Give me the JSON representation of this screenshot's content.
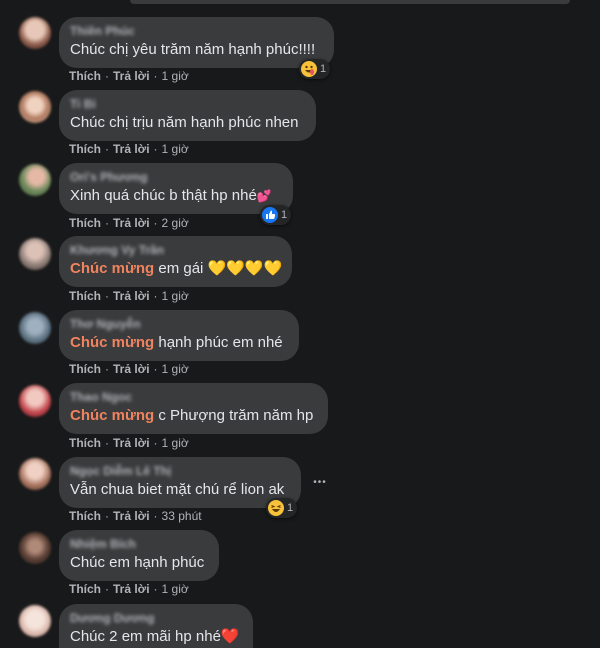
{
  "comments": [
    {
      "name": "Thiên Phúc",
      "text": "Chúc chị yêu trăm năm hạnh phúc!!!!",
      "like": "Thích",
      "reply": "Trả lời",
      "time": "1 giờ",
      "reaction_count": "1",
      "reaction_icon": "laugh-emoji-icon"
    },
    {
      "name": "Ti Bi",
      "text": "Chúc chị trịu năm hạnh phúc nhen",
      "like": "Thích",
      "reply": "Trả lời",
      "time": "1 giờ"
    },
    {
      "name": "Ori's Phương",
      "text": "Xinh quá chúc b thật hp nhé",
      "like": "Thích",
      "reply": "Trả lời",
      "time": "2 giờ",
      "reaction_count": "1",
      "reaction_icon": "like-icon"
    },
    {
      "name": "Khương Vy Trần",
      "tag": "Chúc mừng",
      "text": " em gái 💛💛💛💛",
      "like": "Thích",
      "reply": "Trả lời",
      "time": "1 giờ"
    },
    {
      "name": "Thơ Nguyễn",
      "tag": "Chúc mừng",
      "text": " hạnh phúc em nhé",
      "like": "Thích",
      "reply": "Trả lời",
      "time": "1 giờ"
    },
    {
      "name": "Thao Ngoc",
      "tag": "Chúc mừng",
      "text": " c Phượng trăm năm hp",
      "like": "Thích",
      "reply": "Trả lời",
      "time": "1 giờ"
    },
    {
      "name": "Ngọc Diễm Lê Thị",
      "text": "Vẫn chua biet mặt chú rể lion ak",
      "like": "Thích",
      "reply": "Trả lời",
      "time": "33 phút",
      "reaction_count": "1",
      "reaction_icon": "haha-emoji-icon",
      "more": "•••"
    },
    {
      "name": "Nhiệm Bích",
      "text": "Chúc em hạnh phúc",
      "like": "Thích",
      "reply": "Trả lời",
      "time": "1 giờ"
    },
    {
      "name": "Dương Dương",
      "text": "Chúc 2 em mãi hp nhé",
      "like": "Thích",
      "reply": "Trả lời",
      "time": "1 giờ"
    }
  ],
  "colors": {
    "background": "#18191a",
    "bubble": "#3a3b3c",
    "tag": "#f0835f",
    "secondary_text": "#b0b3b8"
  }
}
